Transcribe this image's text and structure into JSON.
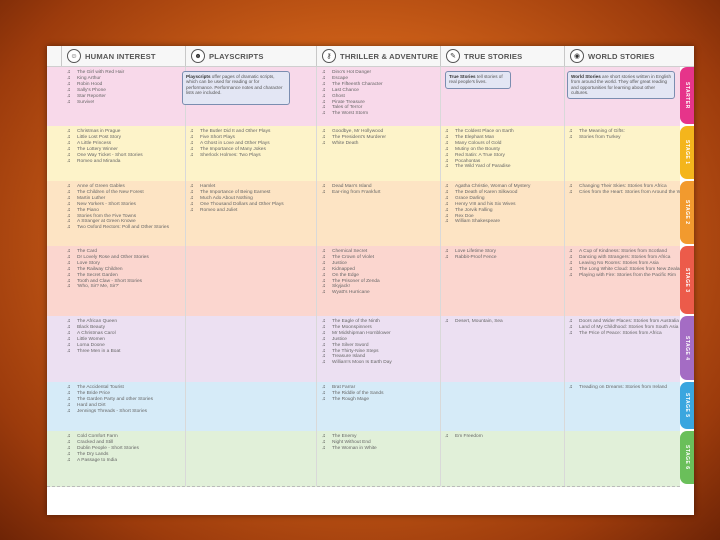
{
  "headers": [
    "HUMAN INTEREST",
    "PLAYSCRIPTS",
    "THRILLER & ADVENTURE",
    "TRUE STORIES",
    "WORLD STORIES"
  ],
  "stages": [
    {
      "label": "STARTER",
      "color": "#e6348a",
      "bg": "#f8d9ea"
    },
    {
      "label": "STAGE 1",
      "color": "#f4b51c",
      "bg": "#fdf3c9"
    },
    {
      "label": "STAGE 2",
      "color": "#f29a2e",
      "bg": "#fde4c4"
    },
    {
      "label": "STAGE 3",
      "color": "#ec5b4a",
      "bg": "#fbd6cf"
    },
    {
      "label": "STAGE 4",
      "color": "#a46cc4",
      "bg": "#ece0f2"
    },
    {
      "label": "STAGE 5",
      "color": "#3aa6df",
      "bg": "#d6ebf8"
    },
    {
      "label": "STAGE 6",
      "color": "#6abf5a",
      "bg": "#e1f0d9"
    }
  ],
  "rows": [
    {
      "human": [
        "The Girl with Red Hair",
        "King Arthur",
        "Robin Hood",
        "Sally's Phone",
        "Star Reporter",
        "Survive!"
      ],
      "plays_box": {
        "title": "Playscripts",
        "text": "offer pages of dramatic scripts, which can be used for reading or for performance. Performance notes and character lists are included."
      },
      "thriller": [
        "Dino's Hot Danger",
        "Escape",
        "The Fifteenth Character",
        "Last Chance",
        "Ghost",
        "Pirate Treasure",
        "Tales of Terror",
        "The Worst Storm"
      ],
      "true_box": {
        "title": "True Stories",
        "text": "tell stories of real people's lives."
      },
      "world_box": {
        "title": "World Stories",
        "text": "are short stories written in English from around the world. They offer great reading and opportunities for learning about other cultures."
      }
    },
    {
      "human": [
        "Christmas in Prague",
        "Little Lost Post Story",
        "A Little Princess",
        "The Lottery Winner",
        "One Way Ticket - Short Stories",
        "Romeo and Miranda"
      ],
      "plays": [
        "The Butler Did It and Other Plays",
        "Five Short Plays",
        "A Ghost in Love and Other Plays",
        "The Importance of Many Jokes",
        "Sherlock Holmes: Two Plays"
      ],
      "thriller": [
        "Goodbye, Mr Hollywood",
        "The President's Murderer",
        "White Death"
      ],
      "true": [
        "The Coldest Place on Earth",
        "The Elephant Man",
        "Many Colours of Gold",
        "Mutiny on the Bounty",
        "Red Satin: A True Story",
        "Pocahontas",
        "The Wild Yard of Paradise"
      ],
      "world": [
        "The Meaning of Gifts:",
        "Stories from Turkey"
      ]
    },
    {
      "human": [
        "Anne of Green Gables",
        "The Children of the New Forest",
        "Martin Luther",
        "New Yorkers - Short Stories",
        "The Piano",
        "Stories from the Five Towns",
        "A Stranger at Green Knowe",
        "Two Oxford Rectors: Poll and Other Stories"
      ],
      "plays": [
        "Hamlet",
        "The Importance of Being Earnest",
        "Much Ado About Nothing",
        "One Thousand Dollars and Other Plays",
        "Romeo and Juliet"
      ],
      "thriller": [
        "Dead Man's Island",
        "Ear-ring from Frankfurt"
      ],
      "true": [
        "Agatha Christie, Woman of Mystery",
        "The Death of Karen Silkwood",
        "Grace Darling",
        "Henry VIII and his Six Wives",
        "The Jorvik Falling",
        "Rex Doe",
        "William Shakespeare"
      ],
      "world": [
        "Changing Their Skies: Stories from Africa",
        "Cries from the Heart: Stories from Around the World"
      ]
    },
    {
      "human": [
        "The Card",
        "Dr Lovely Rose and Other Stories",
        "Love Story",
        "The Railway Children",
        "The Secret Garden",
        "Tooth and Claw - Short Stories",
        "'Who, Sir? Me, Sir?'"
      ],
      "thriller": [
        "Chemical Secret",
        "The Crown of Violet",
        "Justice",
        "Kidnapped",
        "On the Edge",
        "The Prisoner of Zenda",
        "Skyjack!",
        "Wyatt's Hurricane"
      ],
      "true": [
        "Love Lifetime Story",
        "Rabbit-Proof Fence"
      ],
      "world": [
        "A Cup of Kindness: Stories from Scotland",
        "Dancing with Strangers: Stories from Africa",
        "Leaving No Rooms: Stories from Asia",
        "The Long White Cloud: Stories from New Zealand",
        "Playing with Fire: Stories from the Pacific Rim"
      ]
    },
    {
      "human": [
        "The African Queen",
        "Black Beauty",
        "A Christmas Carol",
        "Little Women",
        "Lorna Doone",
        "Three Men in a Boat"
      ],
      "thriller": [
        "The Eagle of the Ninth",
        "The Moonspinners",
        "Mr Midshipman Hornblower",
        "Justice",
        "The Silver Sword",
        "The Thirty-Nine Steps",
        "Treasure Island",
        "William's Moon Is Earth Day"
      ],
      "true": [
        "Desert, Mountain, Sea"
      ],
      "world": [
        "Doors and Wider Places: Stories from Australia",
        "Land of My Childhood: Stories from South Asia",
        "The Price of Peace: Stories from Africa"
      ]
    },
    {
      "human": [
        "The Accidental Tourist",
        "The Bride Price",
        "The Garden Party and other Stories",
        "Hard and Dirt",
        "Jennings Threads - Short Stories"
      ],
      "thriller": [
        "Brat Farrar",
        "The Riddle of the Sands",
        "The Rough Mage"
      ],
      "true": [],
      "world": [
        "Treading on Dreams: Stories from Ireland"
      ]
    },
    {
      "human": [
        "Cold Comfort Farm",
        "Cracked and Still",
        "Dublin People - Short Stories",
        "The Dry Lands",
        "A Passage to India"
      ],
      "thriller": [
        "The Enemy",
        "Night Without End",
        "The Woman in White"
      ],
      "true": [
        "Em Freedom"
      ],
      "world": []
    }
  ]
}
